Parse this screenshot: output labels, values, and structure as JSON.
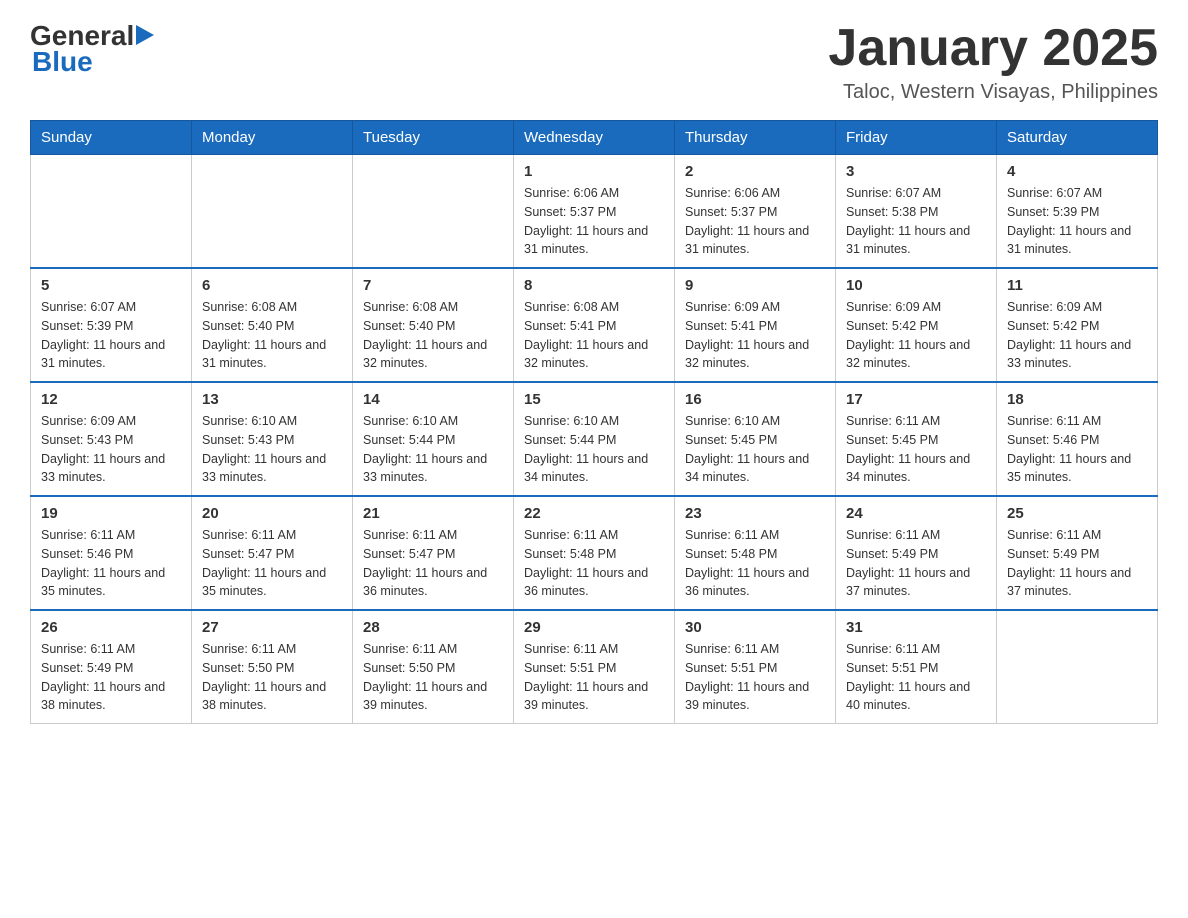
{
  "header": {
    "logo": {
      "general": "General",
      "arrow": "▶",
      "blue": "Blue"
    },
    "title": "January 2025",
    "subtitle": "Taloc, Western Visayas, Philippines"
  },
  "days_of_week": [
    "Sunday",
    "Monday",
    "Tuesday",
    "Wednesday",
    "Thursday",
    "Friday",
    "Saturday"
  ],
  "weeks": [
    [
      {
        "day": "",
        "info": ""
      },
      {
        "day": "",
        "info": ""
      },
      {
        "day": "",
        "info": ""
      },
      {
        "day": "1",
        "info": "Sunrise: 6:06 AM\nSunset: 5:37 PM\nDaylight: 11 hours and 31 minutes."
      },
      {
        "day": "2",
        "info": "Sunrise: 6:06 AM\nSunset: 5:37 PM\nDaylight: 11 hours and 31 minutes."
      },
      {
        "day": "3",
        "info": "Sunrise: 6:07 AM\nSunset: 5:38 PM\nDaylight: 11 hours and 31 minutes."
      },
      {
        "day": "4",
        "info": "Sunrise: 6:07 AM\nSunset: 5:39 PM\nDaylight: 11 hours and 31 minutes."
      }
    ],
    [
      {
        "day": "5",
        "info": "Sunrise: 6:07 AM\nSunset: 5:39 PM\nDaylight: 11 hours and 31 minutes."
      },
      {
        "day": "6",
        "info": "Sunrise: 6:08 AM\nSunset: 5:40 PM\nDaylight: 11 hours and 31 minutes."
      },
      {
        "day": "7",
        "info": "Sunrise: 6:08 AM\nSunset: 5:40 PM\nDaylight: 11 hours and 32 minutes."
      },
      {
        "day": "8",
        "info": "Sunrise: 6:08 AM\nSunset: 5:41 PM\nDaylight: 11 hours and 32 minutes."
      },
      {
        "day": "9",
        "info": "Sunrise: 6:09 AM\nSunset: 5:41 PM\nDaylight: 11 hours and 32 minutes."
      },
      {
        "day": "10",
        "info": "Sunrise: 6:09 AM\nSunset: 5:42 PM\nDaylight: 11 hours and 32 minutes."
      },
      {
        "day": "11",
        "info": "Sunrise: 6:09 AM\nSunset: 5:42 PM\nDaylight: 11 hours and 33 minutes."
      }
    ],
    [
      {
        "day": "12",
        "info": "Sunrise: 6:09 AM\nSunset: 5:43 PM\nDaylight: 11 hours and 33 minutes."
      },
      {
        "day": "13",
        "info": "Sunrise: 6:10 AM\nSunset: 5:43 PM\nDaylight: 11 hours and 33 minutes."
      },
      {
        "day": "14",
        "info": "Sunrise: 6:10 AM\nSunset: 5:44 PM\nDaylight: 11 hours and 33 minutes."
      },
      {
        "day": "15",
        "info": "Sunrise: 6:10 AM\nSunset: 5:44 PM\nDaylight: 11 hours and 34 minutes."
      },
      {
        "day": "16",
        "info": "Sunrise: 6:10 AM\nSunset: 5:45 PM\nDaylight: 11 hours and 34 minutes."
      },
      {
        "day": "17",
        "info": "Sunrise: 6:11 AM\nSunset: 5:45 PM\nDaylight: 11 hours and 34 minutes."
      },
      {
        "day": "18",
        "info": "Sunrise: 6:11 AM\nSunset: 5:46 PM\nDaylight: 11 hours and 35 minutes."
      }
    ],
    [
      {
        "day": "19",
        "info": "Sunrise: 6:11 AM\nSunset: 5:46 PM\nDaylight: 11 hours and 35 minutes."
      },
      {
        "day": "20",
        "info": "Sunrise: 6:11 AM\nSunset: 5:47 PM\nDaylight: 11 hours and 35 minutes."
      },
      {
        "day": "21",
        "info": "Sunrise: 6:11 AM\nSunset: 5:47 PM\nDaylight: 11 hours and 36 minutes."
      },
      {
        "day": "22",
        "info": "Sunrise: 6:11 AM\nSunset: 5:48 PM\nDaylight: 11 hours and 36 minutes."
      },
      {
        "day": "23",
        "info": "Sunrise: 6:11 AM\nSunset: 5:48 PM\nDaylight: 11 hours and 36 minutes."
      },
      {
        "day": "24",
        "info": "Sunrise: 6:11 AM\nSunset: 5:49 PM\nDaylight: 11 hours and 37 minutes."
      },
      {
        "day": "25",
        "info": "Sunrise: 6:11 AM\nSunset: 5:49 PM\nDaylight: 11 hours and 37 minutes."
      }
    ],
    [
      {
        "day": "26",
        "info": "Sunrise: 6:11 AM\nSunset: 5:49 PM\nDaylight: 11 hours and 38 minutes."
      },
      {
        "day": "27",
        "info": "Sunrise: 6:11 AM\nSunset: 5:50 PM\nDaylight: 11 hours and 38 minutes."
      },
      {
        "day": "28",
        "info": "Sunrise: 6:11 AM\nSunset: 5:50 PM\nDaylight: 11 hours and 39 minutes."
      },
      {
        "day": "29",
        "info": "Sunrise: 6:11 AM\nSunset: 5:51 PM\nDaylight: 11 hours and 39 minutes."
      },
      {
        "day": "30",
        "info": "Sunrise: 6:11 AM\nSunset: 5:51 PM\nDaylight: 11 hours and 39 minutes."
      },
      {
        "day": "31",
        "info": "Sunrise: 6:11 AM\nSunset: 5:51 PM\nDaylight: 11 hours and 40 minutes."
      },
      {
        "day": "",
        "info": ""
      }
    ]
  ]
}
